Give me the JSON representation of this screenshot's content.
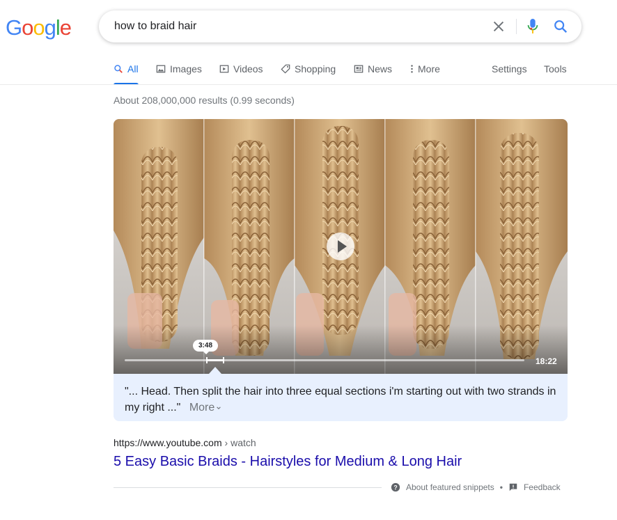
{
  "logo": {
    "letters": [
      "G",
      "o",
      "o",
      "g",
      "l",
      "e"
    ],
    "colors": [
      "#4285f4",
      "#ea4335",
      "#fbbc05",
      "#4285f4",
      "#34a853",
      "#ea4335"
    ]
  },
  "search": {
    "query": "how to braid hair"
  },
  "tabs": [
    {
      "label": "All",
      "icon": "search-icon"
    },
    {
      "label": "Images",
      "icon": "image-icon"
    },
    {
      "label": "Videos",
      "icon": "play-icon"
    },
    {
      "label": "Shopping",
      "icon": "tag-icon"
    },
    {
      "label": "News",
      "icon": "news-icon"
    },
    {
      "label": "More",
      "icon": "kebab-icon"
    }
  ],
  "tools": {
    "settings": "Settings",
    "tools": "Tools"
  },
  "stats": "About 208,000,000 results (0.99 seconds)",
  "video": {
    "timestamp": "3:48",
    "duration": "18:22",
    "progress": 0.207
  },
  "snippet": {
    "quote": "\"... Head. Then split the hair into three equal sections i'm starting out with two strands in my right ...\"",
    "more": "More"
  },
  "result": {
    "url": "https://www.youtube.com",
    "crumb": " › watch",
    "title": "5 Easy Basic Braids - Hairstyles for Medium & Long Hair"
  },
  "footer": {
    "about": "About featured snippets",
    "sep": "•",
    "feedback": "Feedback"
  },
  "colors": {
    "accent": "#1a73e8",
    "link": "#1a0dab",
    "snippet_bg": "#e8f0fe"
  }
}
